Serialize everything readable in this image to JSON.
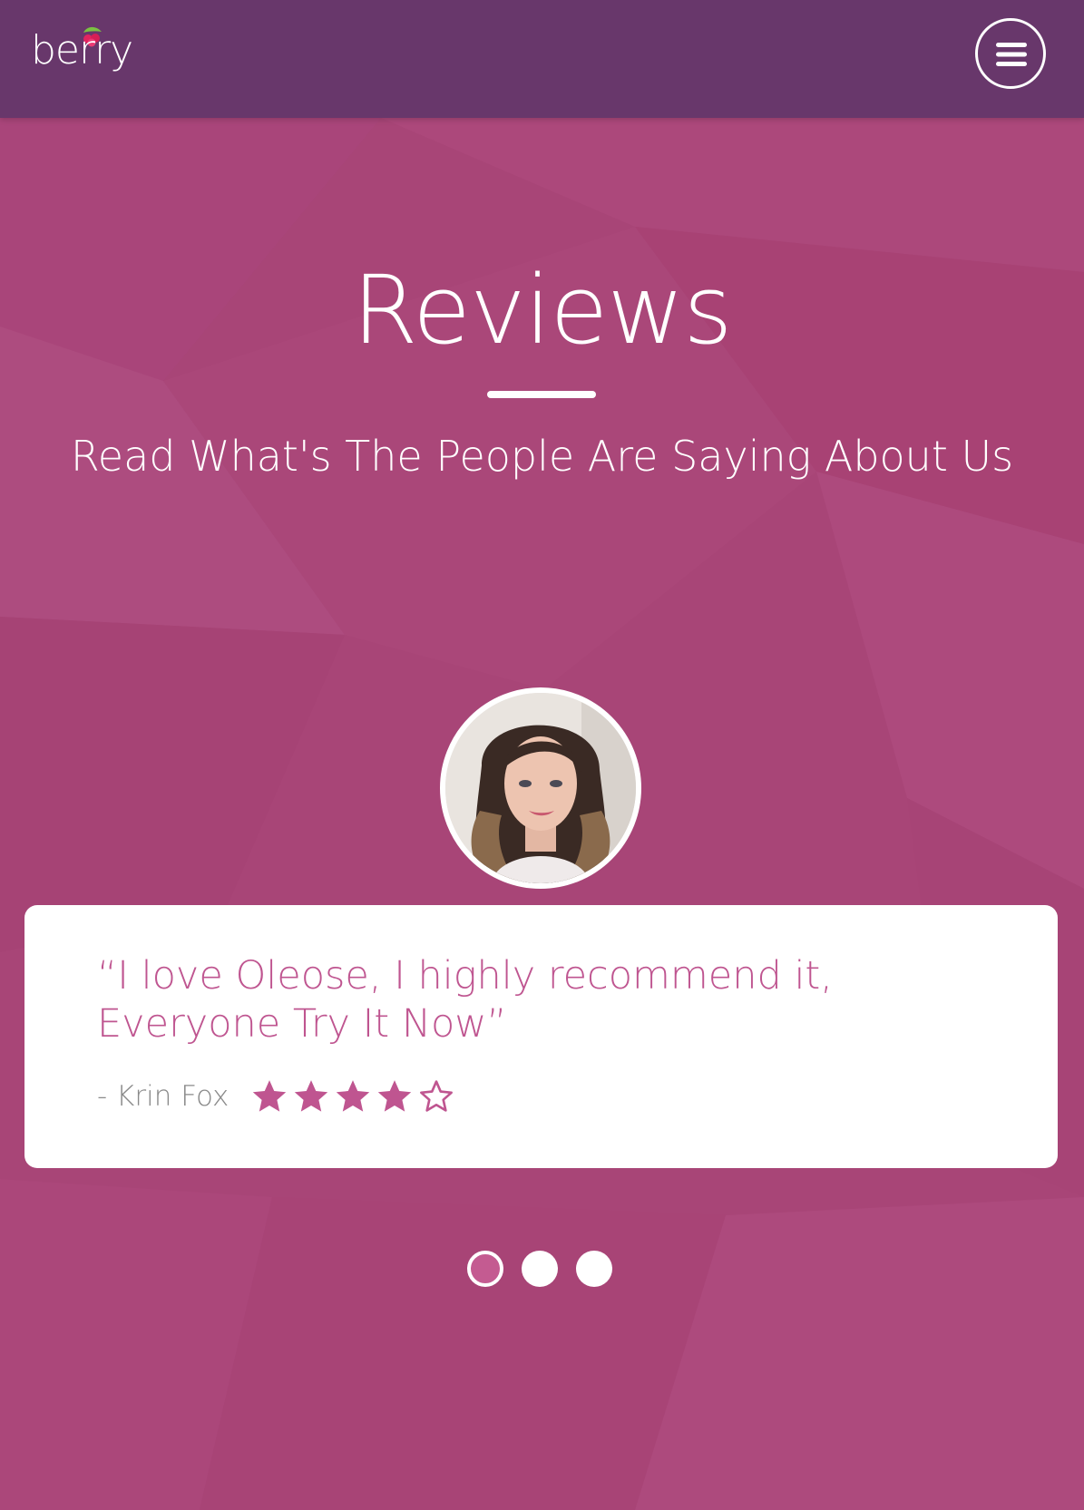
{
  "header": {
    "logo_text": "berry",
    "menu_icon": "hamburger-menu-icon",
    "bar_color": "#68376b"
  },
  "section": {
    "title": "Reviews",
    "subtitle": "Read What's The People Are Saying About Us",
    "background_color": "#a84577"
  },
  "review": {
    "quote": "“I love Oleose, I highly recommend it, Everyone Try It Now”",
    "author": "- Krin Fox",
    "rating": 4,
    "max_rating": 5,
    "accent_color": "#bf5590"
  },
  "carousel": {
    "slides": 3,
    "active_index": 0
  }
}
